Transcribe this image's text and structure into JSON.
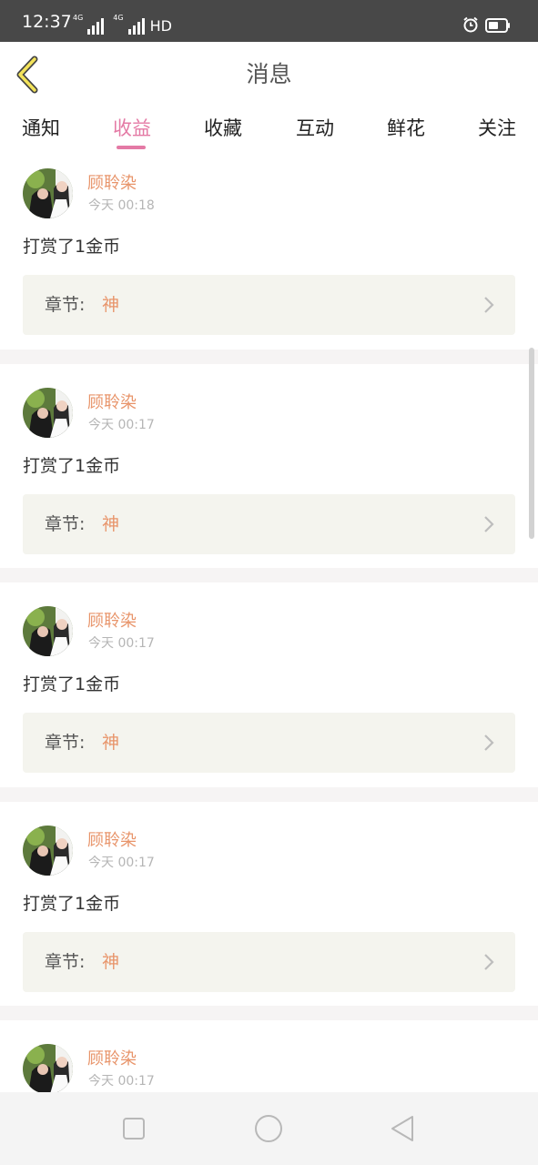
{
  "status": {
    "time": "12:37",
    "network_1": "4G",
    "network_2": "4G",
    "hd": "HD"
  },
  "header": {
    "title": "消息"
  },
  "tabs": [
    {
      "label": "通知",
      "active": false
    },
    {
      "label": "收益",
      "active": true
    },
    {
      "label": "收藏",
      "active": false
    },
    {
      "label": "互动",
      "active": false
    },
    {
      "label": "鲜花",
      "active": false
    },
    {
      "label": "关注",
      "active": false
    }
  ],
  "messages": [
    {
      "user": "顾聆染",
      "time": "今天 00:18",
      "text": "打赏了1金币",
      "chapter_label": "章节:",
      "chapter": "神"
    },
    {
      "user": "顾聆染",
      "time": "今天 00:17",
      "text": "打赏了1金币",
      "chapter_label": "章节:",
      "chapter": "神"
    },
    {
      "user": "顾聆染",
      "time": "今天 00:17",
      "text": "打赏了1金币",
      "chapter_label": "章节:",
      "chapter": "神"
    },
    {
      "user": "顾聆染",
      "time": "今天 00:17",
      "text": "打赏了1金币",
      "chapter_label": "章节:",
      "chapter": "神"
    },
    {
      "user": "顾聆染",
      "time": "今天 00:17",
      "text": "",
      "chapter_label": "",
      "chapter": ""
    }
  ],
  "colors": {
    "accent": "#e47aa5",
    "name": "#e8946a",
    "chapter_bg": "#f4f4ee"
  },
  "icons": {
    "back": "chevron-left-icon",
    "alarm": "alarm-icon",
    "battery": "battery-icon",
    "nav_recent": "square-icon",
    "nav_home": "circle-icon",
    "nav_back": "triangle-back-icon"
  }
}
